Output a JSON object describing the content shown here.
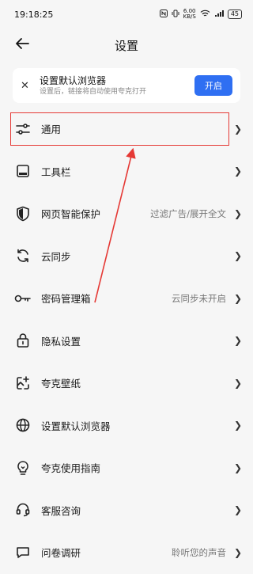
{
  "status_bar": {
    "time": "19:18:25",
    "net_speed_value": "6.00",
    "net_speed_unit": "KB/S",
    "signal_text": "5G",
    "battery": "45"
  },
  "nav": {
    "title": "设置"
  },
  "banner": {
    "title": "设置默认浏览器",
    "subtitle": "设置后，链接将自动使用夸克打开",
    "button_label": "开启"
  },
  "settings": {
    "items": [
      {
        "label": "通用",
        "value": "",
        "icon": "sliders-icon"
      },
      {
        "label": "工具栏",
        "value": "",
        "icon": "toolbar-icon"
      },
      {
        "label": "网页智能保护",
        "value": "过滤广告/展开全文",
        "icon": "shield-icon"
      },
      {
        "label": "云同步",
        "value": "",
        "icon": "sync-icon"
      },
      {
        "label": "密码管理箱",
        "value": "云同步未开启",
        "icon": "key-icon"
      },
      {
        "label": "隐私设置",
        "value": "",
        "icon": "lock-icon"
      },
      {
        "label": "夸克壁纸",
        "value": "",
        "icon": "wallpaper-icon"
      },
      {
        "label": "设置默认浏览器",
        "value": "",
        "icon": "globe-icon"
      },
      {
        "label": "夸克使用指南",
        "value": "",
        "icon": "lightbulb-icon"
      },
      {
        "label": "客服咨询",
        "value": "",
        "icon": "headset-icon"
      },
      {
        "label": "问卷调研",
        "value": "聆听您的声音",
        "icon": "survey-icon"
      }
    ]
  },
  "annotation": {
    "color": "#e53935"
  }
}
